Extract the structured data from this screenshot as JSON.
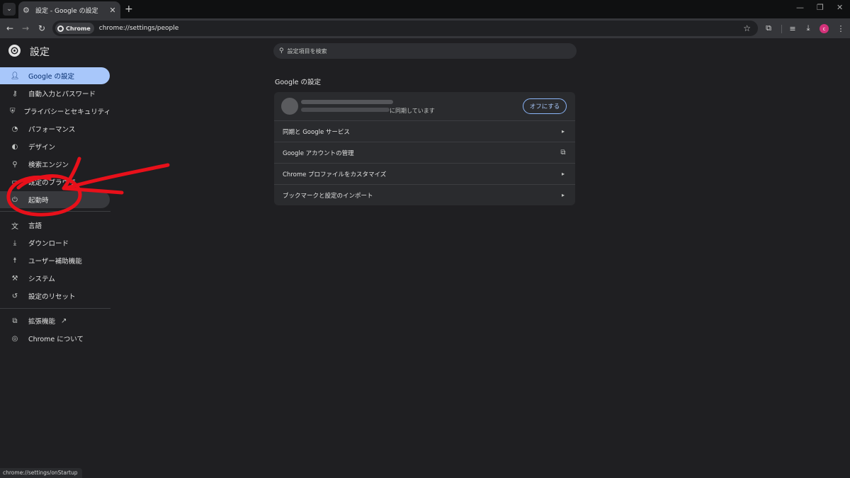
{
  "tab": {
    "title": "設定 - Google の設定"
  },
  "omnibox": {
    "chip": "Chrome",
    "url": "chrome://settings/people"
  },
  "sidebar": {
    "title": "設定",
    "items": [
      {
        "label": "Google の設定",
        "icon": "person-icon"
      },
      {
        "label": "自動入力とパスワード",
        "icon": "key-icon"
      },
      {
        "label": "プライバシーとセキュリティ",
        "icon": "shield-icon"
      },
      {
        "label": "パフォーマンス",
        "icon": "speedometer-icon"
      },
      {
        "label": "デザイン",
        "icon": "palette-icon"
      },
      {
        "label": "検索エンジン",
        "icon": "search-icon"
      },
      {
        "label": "既定のブラウザ",
        "icon": "browser-icon"
      },
      {
        "label": "起動時",
        "icon": "power-icon"
      },
      {
        "label": "言語",
        "icon": "translate-icon"
      },
      {
        "label": "ダウンロード",
        "icon": "download-icon"
      },
      {
        "label": "ユーザー補助機能",
        "icon": "accessibility-icon"
      },
      {
        "label": "システム",
        "icon": "wrench-icon"
      },
      {
        "label": "設定のリセット",
        "icon": "reset-icon"
      },
      {
        "label": "拡張機能",
        "icon": "puzzle-icon"
      },
      {
        "label": "Chrome について",
        "icon": "chrome-icon"
      }
    ]
  },
  "search": {
    "placeholder": "設定項目を検索"
  },
  "main": {
    "section_title": "Google の設定",
    "sync_status": "に同期しています",
    "off_button": "オフにする",
    "rows": [
      {
        "label": "同期と Google サービス",
        "icon": "chevron-right-icon"
      },
      {
        "label": "Google アカウントの管理",
        "icon": "external-link-icon"
      },
      {
        "label": "Chrome プロファイルをカスタマイズ",
        "icon": "chevron-right-icon"
      },
      {
        "label": "ブックマークと設定のインポート",
        "icon": "chevron-right-icon"
      }
    ]
  },
  "statusbar": {
    "text": "chrome://settings/onStartup"
  },
  "colors": {
    "accent": "#a8c7fa",
    "background": "#1f1f22",
    "annotation": "#e8101a"
  }
}
